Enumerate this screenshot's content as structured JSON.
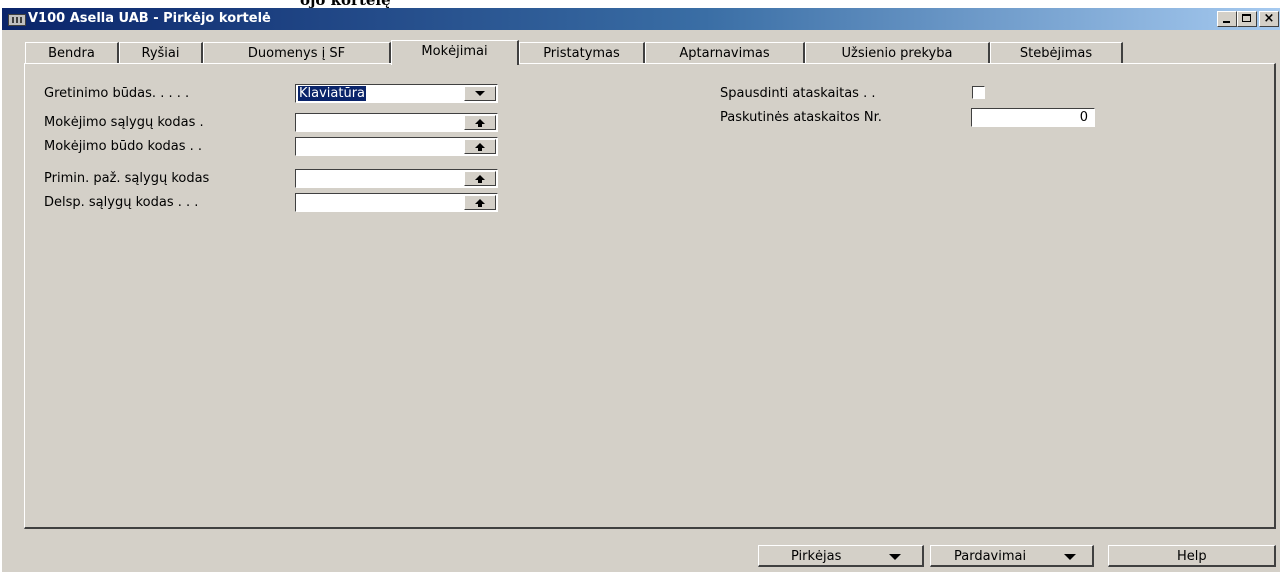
{
  "top_fragment": "ojo kortelę",
  "window": {
    "title": "V100 Asella UAB - Pirkėjo kortelė",
    "minimize_label": "_",
    "maximize_label": "",
    "close_label": "×"
  },
  "tabs": [
    {
      "label": "Bendra"
    },
    {
      "label": "Ryšiai"
    },
    {
      "label": "Duomenys į SF"
    },
    {
      "label": "Mokėjimai",
      "active": true
    },
    {
      "label": "Pristatymas"
    },
    {
      "label": "Aptarnavimas"
    },
    {
      "label": "Užsienio prekyba"
    },
    {
      "label": "Stebėjimas"
    }
  ],
  "left_fields": [
    {
      "label": "Gretinimo būdas. . . . .",
      "value": "Klaviatūra",
      "type": "dropdown"
    },
    {
      "label": "Mokėjimo sąlygų kodas  .",
      "value": "",
      "type": "lookup"
    },
    {
      "label": "Mokėjimo būdo kodas  . .",
      "value": "",
      "type": "lookup"
    },
    {
      "label": "Primin. paž. sąlygų kodas",
      "value": "",
      "type": "lookup"
    },
    {
      "label": "Delsp. sąlygų kodas . . .",
      "value": "",
      "type": "lookup"
    }
  ],
  "right_fields": {
    "print_statements": {
      "label": "Spausdinti ataskaitas  . .",
      "checked": false
    },
    "last_statement_no": {
      "label": "Paskutinės ataskaitos Nr.",
      "value": "0"
    }
  },
  "buttons": {
    "customer": "Pirkėjas",
    "sales": "Pardavimai",
    "help": "Help"
  }
}
